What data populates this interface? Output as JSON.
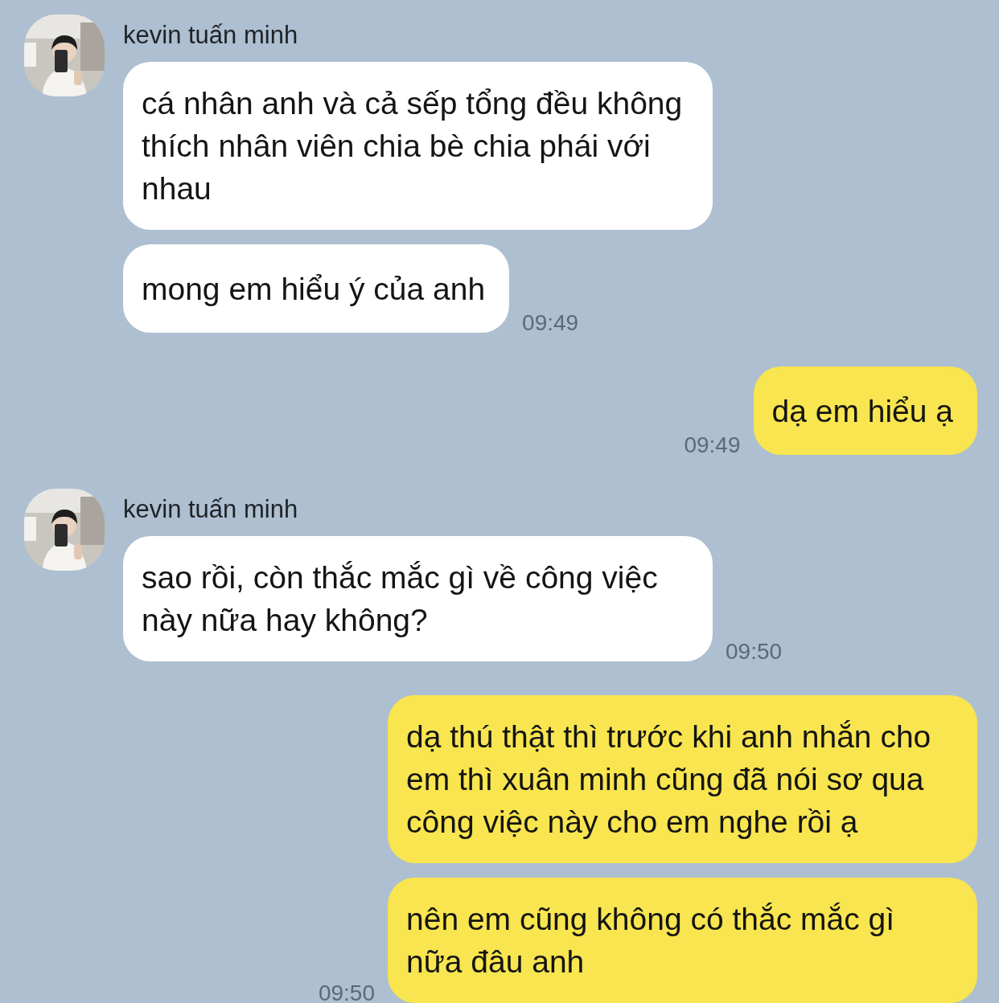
{
  "messages": [
    {
      "kind": "incoming",
      "sender": "kevin tuấn minh",
      "bubbles": [
        "cá nhân anh và cả sếp tổng đều không thích nhân viên chia bè chia phái với nhau",
        "mong em hiểu ý của anh"
      ],
      "time": "09:49"
    },
    {
      "kind": "outgoing",
      "bubbles": [
        "dạ em hiểu ạ"
      ],
      "time": "09:49"
    },
    {
      "kind": "incoming",
      "sender": "kevin tuấn minh",
      "bubbles": [
        "sao rồi, còn thắc mắc gì về công việc này nữa hay không?"
      ],
      "time": "09:50"
    },
    {
      "kind": "outgoing",
      "bubbles": [
        "dạ thú thật thì trước khi anh nhắn cho em thì xuân minh cũng đã nói sơ qua công việc này cho em nghe rồi ạ",
        "nên em cũng không có thắc mắc gì nữa đâu anh"
      ],
      "time": "09:50"
    }
  ]
}
